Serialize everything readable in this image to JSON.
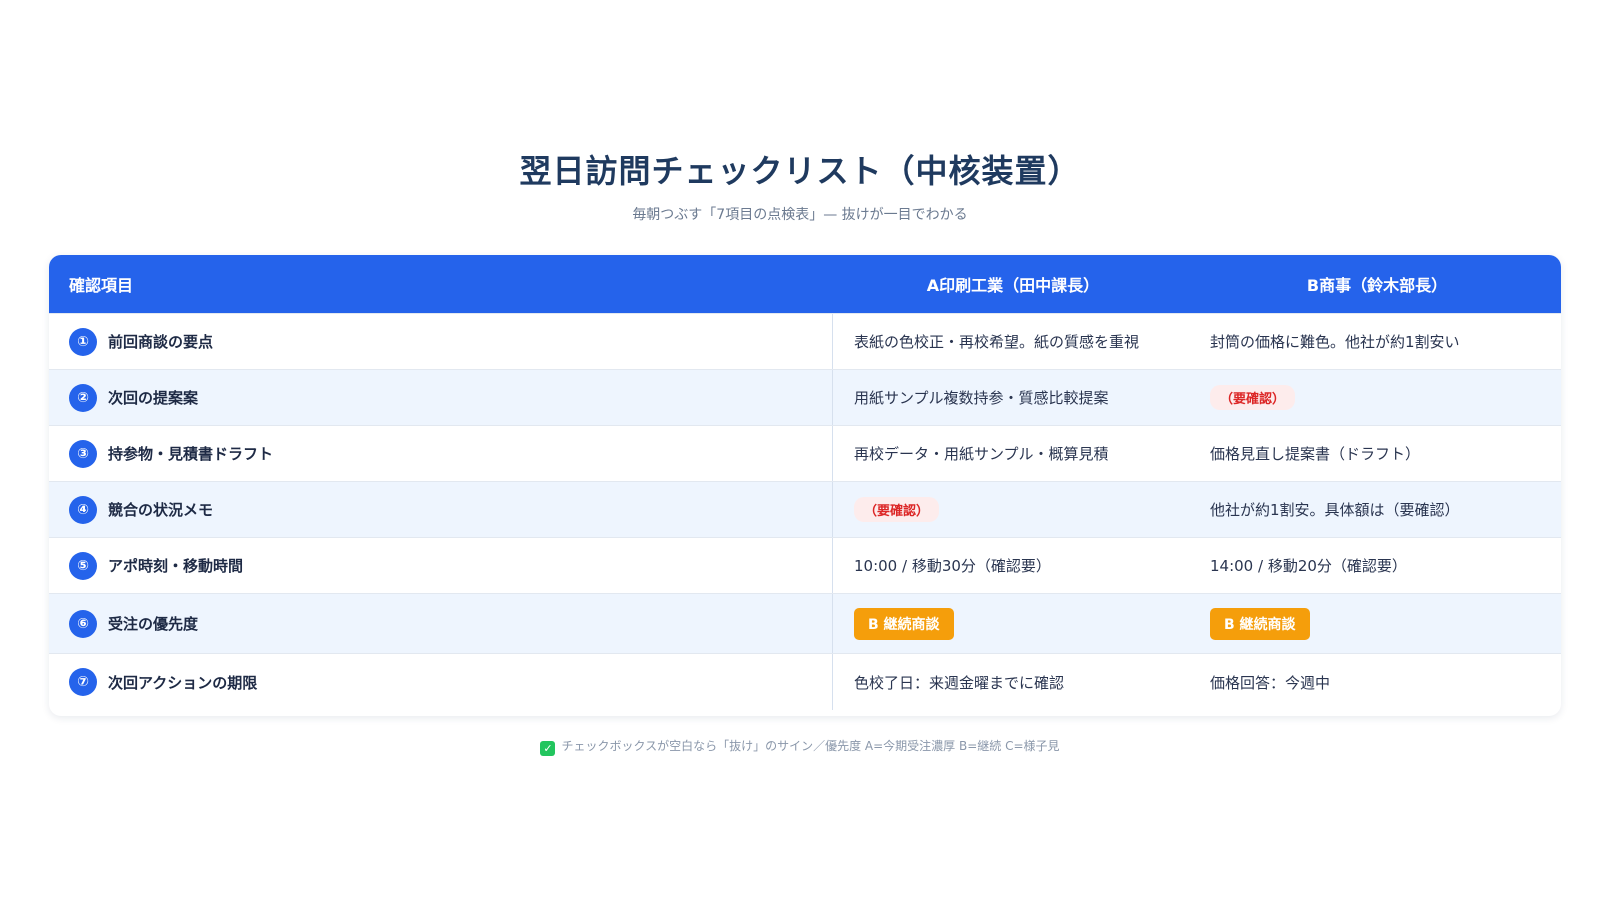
{
  "title": "翌日訪問チェックリスト（中核装置）",
  "subtitle": "毎朝つぶす「7項目の点検表」— 抜けが一目でわかる",
  "table": {
    "headers": {
      "item": "確認項目",
      "a": "A印刷工業（田中課長）",
      "b": "B商事（鈴木部長）"
    },
    "rows": [
      {
        "num": "①",
        "label": "前回商談の要点",
        "a": "表紙の色校正・再校希望。紙の質感を重視",
        "b": "封筒の価格に難色。他社が約1割安い"
      },
      {
        "num": "②",
        "label": "次回の提案案",
        "a": "用紙サンプル複数持参・質感比較提案",
        "b": "（要確認）"
      },
      {
        "num": "③",
        "label": "持参物・見積書ドラフト",
        "a": "再校データ・用紙サンプル・概算見積",
        "b": "価格見直し提案書（ドラフト）"
      },
      {
        "num": "④",
        "label": "競合の状況メモ",
        "a": "（要確認）",
        "b": "他社が約1割安。具体額は（要確認）"
      },
      {
        "num": "⑤",
        "label": "アポ時刻・移動時間",
        "a": "10:00 / 移動30分（確認要）",
        "b": "14:00 / 移動20分（確認要）"
      },
      {
        "num": "⑥",
        "label": "受注の優先度",
        "a": "B 継続商談",
        "b": "B 継続商談"
      },
      {
        "num": "⑦",
        "label": "次回アクションの期限",
        "a": "色校了日：来週金曜までに確認",
        "b": "価格回答：今週中"
      }
    ]
  },
  "footnote": {
    "icon": "check-box-icon",
    "text": "チェックボックスが空白なら「抜け」のサイン／優先度 A=今期受注濃厚 B=継続 C=様子見"
  },
  "colors": {
    "header_bg": "#2563eb",
    "alt_row_bg": "#eef5fe",
    "warn_text": "#dc2626",
    "warn_bg": "#fdecec",
    "badge_bg": "#f59e0b",
    "check_icon": "#22c55e"
  }
}
